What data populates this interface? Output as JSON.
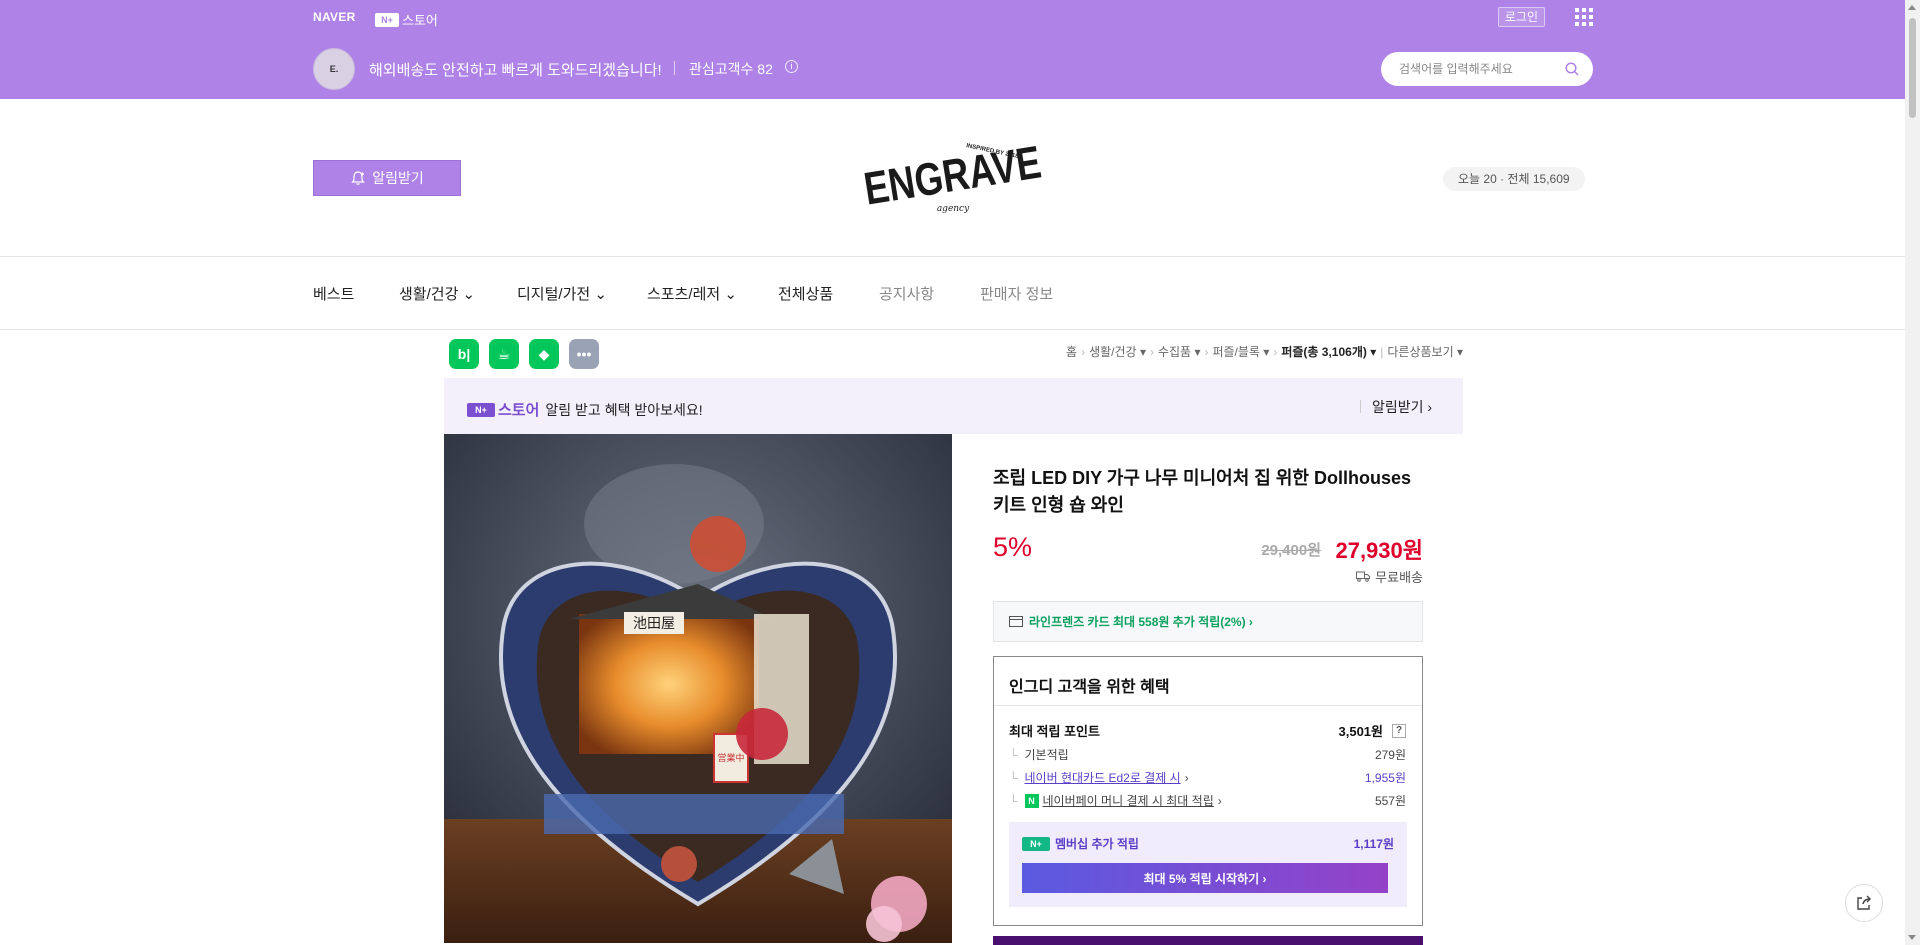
{
  "gnb": {
    "naver": "NAVER",
    "np_mark": "N+",
    "store_label": "스토어",
    "login": "로그인"
  },
  "store": {
    "avatar": "E.",
    "message": "해외배송도 안전하고 빠르게 도와드리겠습니다!",
    "favorites": "관심고객수 82",
    "info_icon": "i"
  },
  "search": {
    "placeholder": "검색어를 입력해주세요"
  },
  "brand": {
    "alarm_label": "알림받기",
    "visitors": "오늘 20 · 전체 15,609",
    "logo_top": "INSPIRED BY 2018",
    "logo_name": "ENGRAVE",
    "logo_sub": "agency"
  },
  "nav": {
    "best": "베스트",
    "life": "생활/건강",
    "digital": "디지털/가전",
    "sports": "스포츠/레저",
    "all": "전체상품",
    "notice": "공지사항",
    "seller": "판매자 정보"
  },
  "service_icons": {
    "blog": "b|",
    "talk": "☕",
    "bookmark": "◆",
    "more": "•••"
  },
  "breadcrumb": [
    "홈",
    "생활/건강",
    "수집품",
    "퍼즐/블록",
    "퍼즐(총 3,106개)",
    "다른상품보기"
  ],
  "promo": {
    "np_mark": "N+",
    "store": "스토어",
    "text": "알림 받고 혜택 받아보세요!",
    "alarm": "알림받기 ›"
  },
  "product": {
    "title": "조립 LED DIY 가구 나무 미니어처 집 위한 Dollhouses 키트 인형 숍 와인",
    "discount": "5%",
    "original_price": "29,400원",
    "sale_price": "27,930원",
    "shipping": "무료배송",
    "card_promo": "라인프렌즈 카드 최대 558원 추가 적립(2%) ›",
    "photo_sign": "池田屋",
    "photo_sign2": "営業中"
  },
  "benefit": {
    "title": "인그디 고객을 위한 혜택",
    "max_points_label": "최대 적립 포인트",
    "max_points_value": "3,501원",
    "qmark": "?",
    "base_label": "기본적립",
    "base_value": "279원",
    "card_label": "네이버 현대카드 Ed2로 결제 시",
    "card_value": "1,955원",
    "pay_label": "네이버페이 머니 결제 시 최대 적립",
    "pay_value": "557원",
    "pay_icon": "N",
    "member_mark": "N+",
    "member_label": "멤버십 추가 적립",
    "member_value": "1,117원",
    "member_button": "최대 5% 적립 시작하기 ›"
  },
  "colors": {
    "top_bar": "#ae82e6",
    "accent_red": "#e0002b",
    "member_purple": "#5a3ec8",
    "card_green": "#0aa05d"
  }
}
